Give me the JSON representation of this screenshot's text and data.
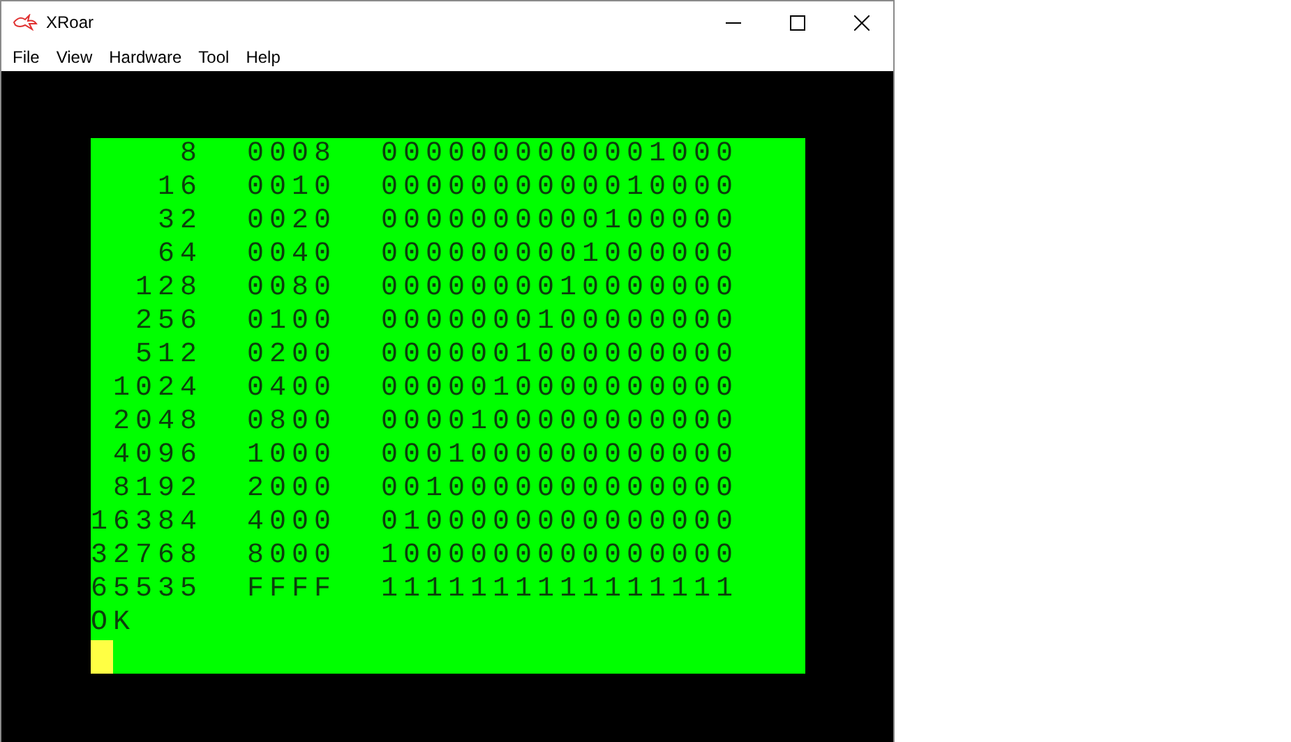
{
  "window": {
    "title": "XRoar"
  },
  "menu": [
    "File",
    "View",
    "Hardware",
    "Tool",
    "Help"
  ],
  "screen": {
    "rows": [
      {
        "decimal": "8",
        "hex": "0008",
        "binary": "0000000000001000"
      },
      {
        "decimal": "16",
        "hex": "0010",
        "binary": "0000000000010000"
      },
      {
        "decimal": "32",
        "hex": "0020",
        "binary": "0000000000100000"
      },
      {
        "decimal": "64",
        "hex": "0040",
        "binary": "0000000001000000"
      },
      {
        "decimal": "128",
        "hex": "0080",
        "binary": "0000000010000000"
      },
      {
        "decimal": "256",
        "hex": "0100",
        "binary": "0000000100000000"
      },
      {
        "decimal": "512",
        "hex": "0200",
        "binary": "0000001000000000"
      },
      {
        "decimal": "1024",
        "hex": "0400",
        "binary": "0000010000000000"
      },
      {
        "decimal": "2048",
        "hex": "0800",
        "binary": "0000100000000000"
      },
      {
        "decimal": "4096",
        "hex": "1000",
        "binary": "0001000000000000"
      },
      {
        "decimal": "8192",
        "hex": "2000",
        "binary": "0010000000000000"
      },
      {
        "decimal": "16384",
        "hex": "4000",
        "binary": "0100000000000000"
      },
      {
        "decimal": "32768",
        "hex": "8000",
        "binary": "1000000000000000"
      },
      {
        "decimal": "65535",
        "hex": "FFFF",
        "binary": "1111111111111111"
      }
    ],
    "prompt": "OK"
  }
}
